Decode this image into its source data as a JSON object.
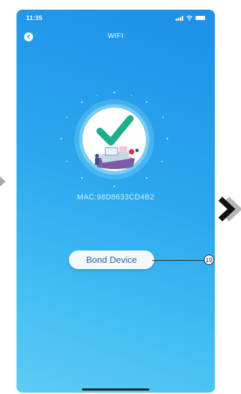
{
  "status_bar": {
    "time": "11:35",
    "icons": [
      "signal-icon",
      "wifi-icon",
      "battery-icon"
    ]
  },
  "nav": {
    "title": "WIFI",
    "back_icon": "chevron-left-icon"
  },
  "device": {
    "mac": "MAC:98D8633CD4B2",
    "status_icon": "checkmark-icon"
  },
  "actions": {
    "bond_label": "Bond Device"
  },
  "callout": {
    "number": "19"
  },
  "colors": {
    "background_top": "#1e8fe6",
    "background_bottom": "#5dcbf5",
    "check_green": "#1fae8b",
    "button_text": "#2a5fa8"
  }
}
